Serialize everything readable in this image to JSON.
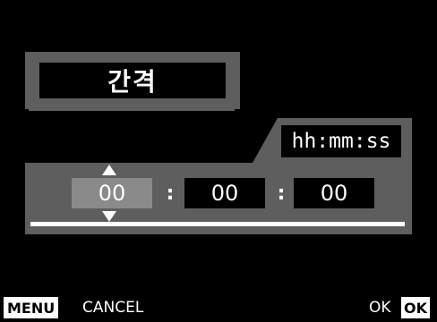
{
  "title": {
    "text": "간격"
  },
  "time_setting": {
    "format_label": "hh:mm:ss",
    "hours": "00",
    "minutes": "00",
    "seconds": "00",
    "separator": ":"
  },
  "bottom_bar": {
    "menu_button": "MENU",
    "cancel_label": "CANCEL",
    "ok_label": "OK",
    "ok_button": "OK"
  },
  "colors": {
    "background": "#000000",
    "panel": "#5e5e5e",
    "selected_field": "#8a8a8a",
    "text": "#ffffff"
  }
}
